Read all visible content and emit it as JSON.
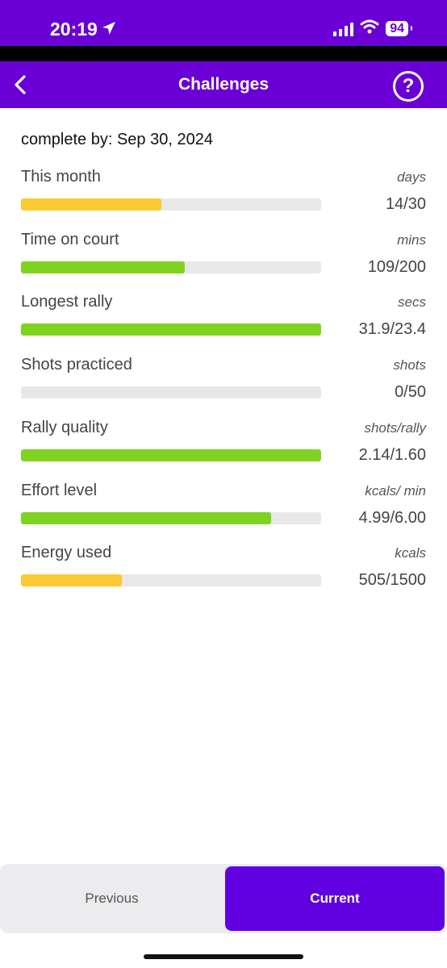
{
  "status_bar": {
    "time": "20:19",
    "battery": "94",
    "icons": [
      "location-arrow-icon",
      "signal-icon",
      "wifi-icon",
      "battery-icon"
    ]
  },
  "header": {
    "title": "Challenges",
    "back_icon": "chevron-left-icon",
    "help_label": "?",
    "help_icon": "question-circle-icon",
    "background": "#6a00d6"
  },
  "complete_by": "complete by: Sep 30, 2024",
  "challenges": [
    {
      "label": "This month",
      "unit": "days",
      "value": "14/30",
      "progress": 0.467,
      "color": "#fbc934"
    },
    {
      "label": "Time on court",
      "unit": "mins",
      "value": "109/200",
      "progress": 0.545,
      "color": "#7ed321"
    },
    {
      "label": "Longest rally",
      "unit": "secs",
      "value": "31.9/23.4",
      "progress": 1.0,
      "color": "#7ed321"
    },
    {
      "label": "Shots practiced",
      "unit": "shots",
      "value": "0/50",
      "progress": 0.0,
      "color": "#7ed321"
    },
    {
      "label": "Rally quality",
      "unit": "shots/rally",
      "value": "2.14/1.60",
      "progress": 1.0,
      "color": "#7ed321"
    },
    {
      "label": "Effort level",
      "unit": "kcals/ min",
      "value": "4.99/6.00",
      "progress": 0.832,
      "color": "#7ed321"
    },
    {
      "label": "Energy used",
      "unit": "kcals",
      "value": "505/1500",
      "progress": 0.337,
      "color": "#fbc934"
    }
  ],
  "tabs": {
    "previous": "Previous",
    "current": "Current",
    "active": "current",
    "active_color": "#6000e0"
  }
}
